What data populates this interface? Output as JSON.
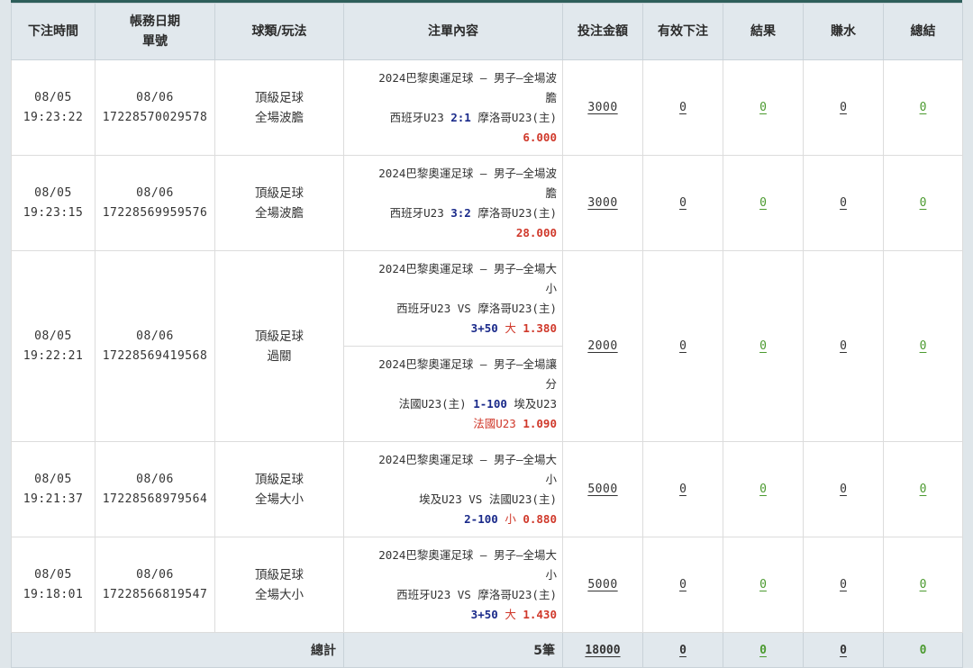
{
  "headers": {
    "time": "下注時間",
    "date_line1": "帳務日期",
    "date_line2": "單號",
    "game": "球類/玩法",
    "content": "注單內容",
    "amount": "投注金額",
    "valid": "有效下注",
    "result": "結果",
    "rebate": "賺水",
    "total": "總結"
  },
  "rows": [
    {
      "date": "08/05",
      "time": "19:23:22",
      "acct_date": "08/06",
      "order_no": "17228570029578",
      "sport": "頂級足球",
      "play": "全場波膽",
      "bets": [
        {
          "league_1": "2024巴黎奧運足球 – 男子–全場波",
          "league_2": "膽",
          "home": "西班牙U23",
          "mid": "2:1",
          "away": "摩洛哥U23(主)",
          "pick": "",
          "odds": "6.000"
        }
      ],
      "amount": "3000",
      "valid": "0",
      "result": "0",
      "rebate": "0",
      "total": "0"
    },
    {
      "date": "08/05",
      "time": "19:23:15",
      "acct_date": "08/06",
      "order_no": "17228569959576",
      "sport": "頂級足球",
      "play": "全場波膽",
      "bets": [
        {
          "league_1": "2024巴黎奧運足球 – 男子–全場波",
          "league_2": "膽",
          "home": "西班牙U23",
          "mid": "3:2",
          "away": "摩洛哥U23(主)",
          "pick": "",
          "odds": "28.000"
        }
      ],
      "amount": "3000",
      "valid": "0",
      "result": "0",
      "rebate": "0",
      "total": "0"
    },
    {
      "date": "08/05",
      "time": "19:22:21",
      "acct_date": "08/06",
      "order_no": "17228569419568",
      "sport": "頂級足球",
      "play": "過關",
      "bets": [
        {
          "league_1": "2024巴黎奧運足球 – 男子–全場大",
          "league_2": "小",
          "home": "西班牙U23",
          "mid": "VS",
          "away": "摩洛哥U23(主)",
          "handicap": "3+50",
          "pick": "大",
          "odds": "1.380"
        },
        {
          "league_1": "2024巴黎奧運足球 – 男子–全場讓",
          "league_2": "分",
          "home": "法國U23(主)",
          "mid": "1-100",
          "away": "埃及U23",
          "handicap": "",
          "pick": "法國U23",
          "odds": "1.090"
        }
      ],
      "amount": "2000",
      "valid": "0",
      "result": "0",
      "rebate": "0",
      "total": "0"
    },
    {
      "date": "08/05",
      "time": "19:21:37",
      "acct_date": "08/06",
      "order_no": "17228568979564",
      "sport": "頂級足球",
      "play": "全場大小",
      "bets": [
        {
          "league_1": "2024巴黎奧運足球 – 男子–全場大",
          "league_2": "小",
          "home": "埃及U23",
          "mid": "VS",
          "away": "法國U23(主)",
          "handicap": "2-100",
          "pick": "小",
          "odds": "0.880"
        }
      ],
      "amount": "5000",
      "valid": "0",
      "result": "0",
      "rebate": "0",
      "total": "0"
    },
    {
      "date": "08/05",
      "time": "19:18:01",
      "acct_date": "08/06",
      "order_no": "17228566819547",
      "sport": "頂級足球",
      "play": "全場大小",
      "bets": [
        {
          "league_1": "2024巴黎奧運足球 – 男子–全場大",
          "league_2": "小",
          "home": "西班牙U23",
          "mid": "VS",
          "away": "摩洛哥U23(主)",
          "handicap": "3+50",
          "pick": "大",
          "odds": "1.430"
        }
      ],
      "amount": "5000",
      "valid": "0",
      "result": "0",
      "rebate": "0",
      "total": "0"
    }
  ],
  "totals": {
    "label": "總計",
    "count": "5筆",
    "amount": "18000",
    "valid": "0",
    "result": "0",
    "rebate": "0",
    "total": "0"
  },
  "colors": {
    "header_bg": "#e1e8ed",
    "accent_top": "#2e5e5a",
    "team_blue": "#1a2a8a",
    "odds_red": "#d0392b",
    "result_green": "#4b9a2f"
  }
}
